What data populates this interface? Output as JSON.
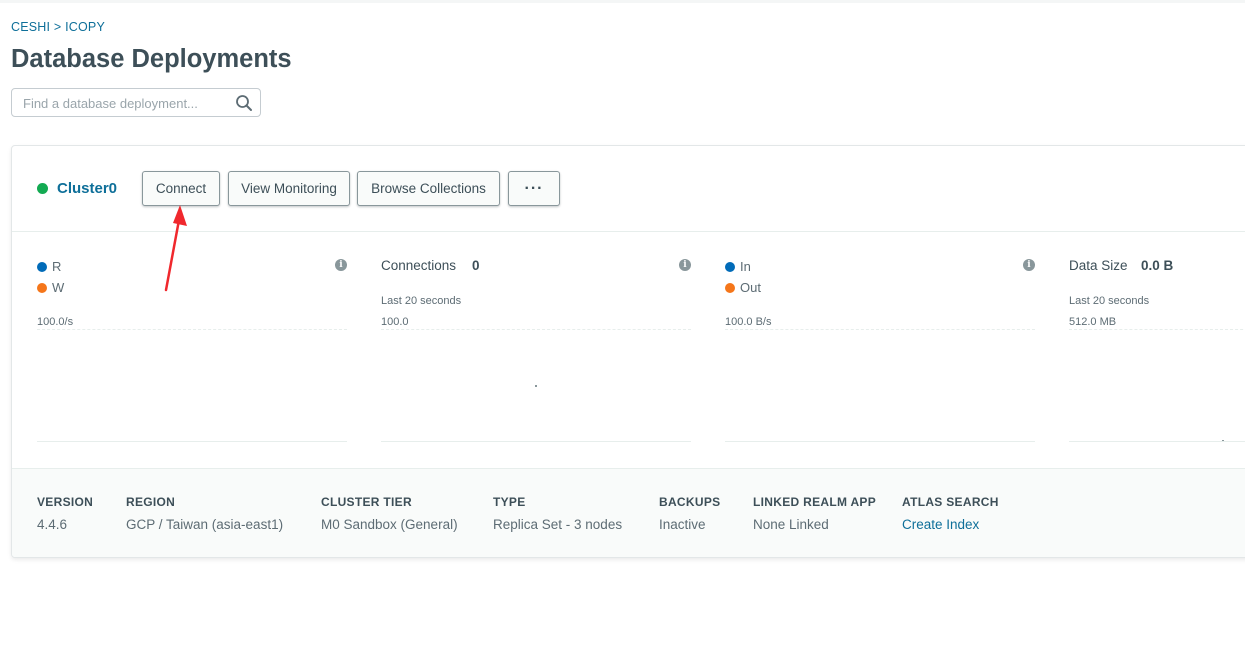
{
  "breadcrumb": {
    "org": "CESHI",
    "separator": ">",
    "project": "ICOPY"
  },
  "page_title": "Database Deployments",
  "search": {
    "placeholder": "Find a database deployment..."
  },
  "cluster": {
    "name": "Cluster0",
    "status_color": "#13aa52",
    "buttons": {
      "connect": "Connect",
      "view_monitoring": "View Monitoring",
      "browse_collections": "Browse Collections",
      "more": "···"
    }
  },
  "metrics": [
    {
      "legend": [
        {
          "label": "R",
          "color": "#016bb8"
        },
        {
          "label": "W",
          "color": "#f5761a"
        }
      ],
      "axis_top": "100.0/s"
    },
    {
      "title": "Connections",
      "value": "0",
      "subtitle": "Last 20 seconds",
      "axis_top": "100.0"
    },
    {
      "legend": [
        {
          "label": "In",
          "color": "#016bb8"
        },
        {
          "label": "Out",
          "color": "#f5761a"
        }
      ],
      "axis_top": "100.0 B/s"
    },
    {
      "title": "Data Size",
      "value": "0.0 B",
      "subtitle": "Last 20 seconds",
      "axis_top": "512.0 MB"
    }
  ],
  "footer": {
    "version": {
      "label": "VERSION",
      "value": "4.4.6"
    },
    "region": {
      "label": "REGION",
      "value": "GCP / Taiwan (asia-east1)"
    },
    "cluster_tier": {
      "label": "CLUSTER TIER",
      "value": "M0 Sandbox (General)"
    },
    "type": {
      "label": "TYPE",
      "value": "Replica Set - 3 nodes"
    },
    "backups": {
      "label": "BACKUPS",
      "value": "Inactive"
    },
    "linked_realm_app": {
      "label": "LINKED REALM APP",
      "value": "None Linked"
    },
    "atlas_search": {
      "label": "ATLAS SEARCH",
      "value": "Create Index"
    }
  },
  "colors": {
    "link": "#0e6f99",
    "annotation_arrow": "#f0282d"
  }
}
